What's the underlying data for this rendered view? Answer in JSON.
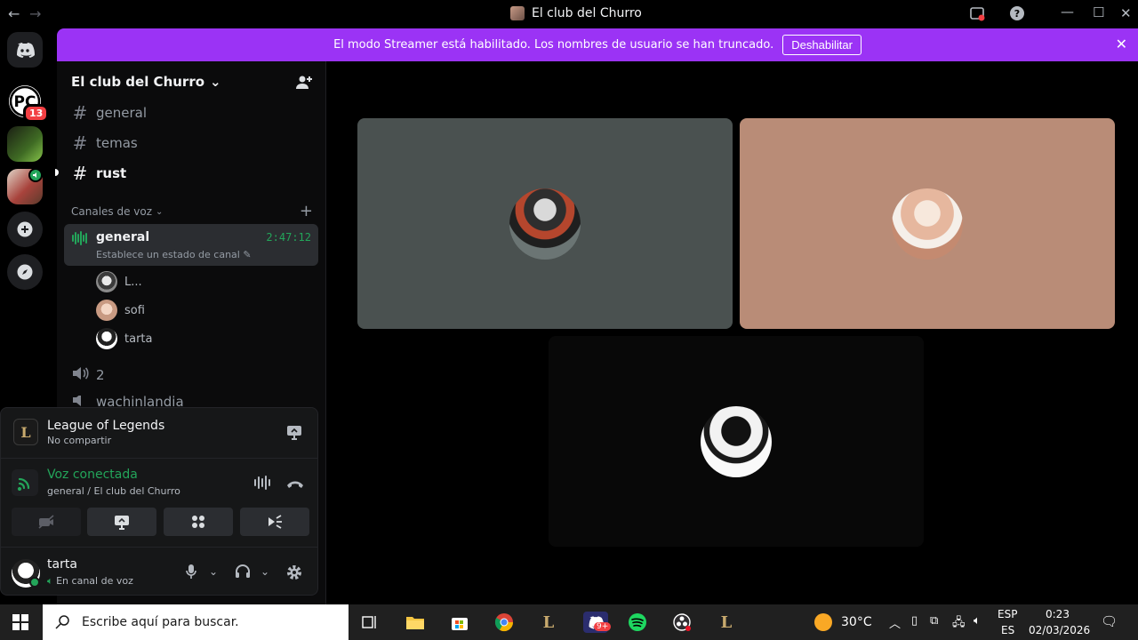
{
  "window": {
    "title": "El club del Churro",
    "back": "←",
    "forward": "→"
  },
  "banner": {
    "message": "El modo Streamer está habilitado. Los nombres de usuario se han truncado.",
    "button": "Deshabilitar",
    "close": "✕"
  },
  "servers": [
    {
      "name": "discord-home-icon"
    },
    {
      "name": "server-pc",
      "badge": "13"
    },
    {
      "name": "server-green"
    },
    {
      "name": "server-voice"
    },
    {
      "name": "add-server-icon"
    },
    {
      "name": "explore-icon"
    }
  ],
  "sidebar": {
    "guild_name": "El club del Churro",
    "channels": [
      {
        "label": "general"
      },
      {
        "label": "temas"
      },
      {
        "label": "rust"
      }
    ],
    "voice_category": "Canales de voz",
    "voice_channel": {
      "name": "general",
      "time": "2:47:12",
      "status": "Establece un estado de canal"
    },
    "voice_users": [
      {
        "name": "L..."
      },
      {
        "name": "sofi"
      },
      {
        "name": "tarta"
      }
    ],
    "other_voice": [
      {
        "label": "2"
      },
      {
        "label": "wachinlandia"
      }
    ]
  },
  "activity": {
    "game": "League of Legends",
    "share_status": "No compartir"
  },
  "voice_connection": {
    "title": "Voz conectada",
    "location": "general / El club del Churro"
  },
  "user": {
    "name": "tarta",
    "status": "En canal de voz"
  },
  "stage": {
    "tiles": [
      {
        "color": "#4a5150"
      },
      {
        "color": "#b98c77"
      },
      {
        "color": "#080808"
      }
    ]
  },
  "taskbar": {
    "search_placeholder": "Escribe aquí para buscar.",
    "temperature": "30°C",
    "lang_top": "ESP",
    "lang_bottom": "ES",
    "time": "0:23",
    "date": "02/03/2026",
    "discord_badge": "9+"
  },
  "colors": {
    "banner": "#9b33f5",
    "voice_green": "#23a55a",
    "badge_red": "#f23f43"
  }
}
